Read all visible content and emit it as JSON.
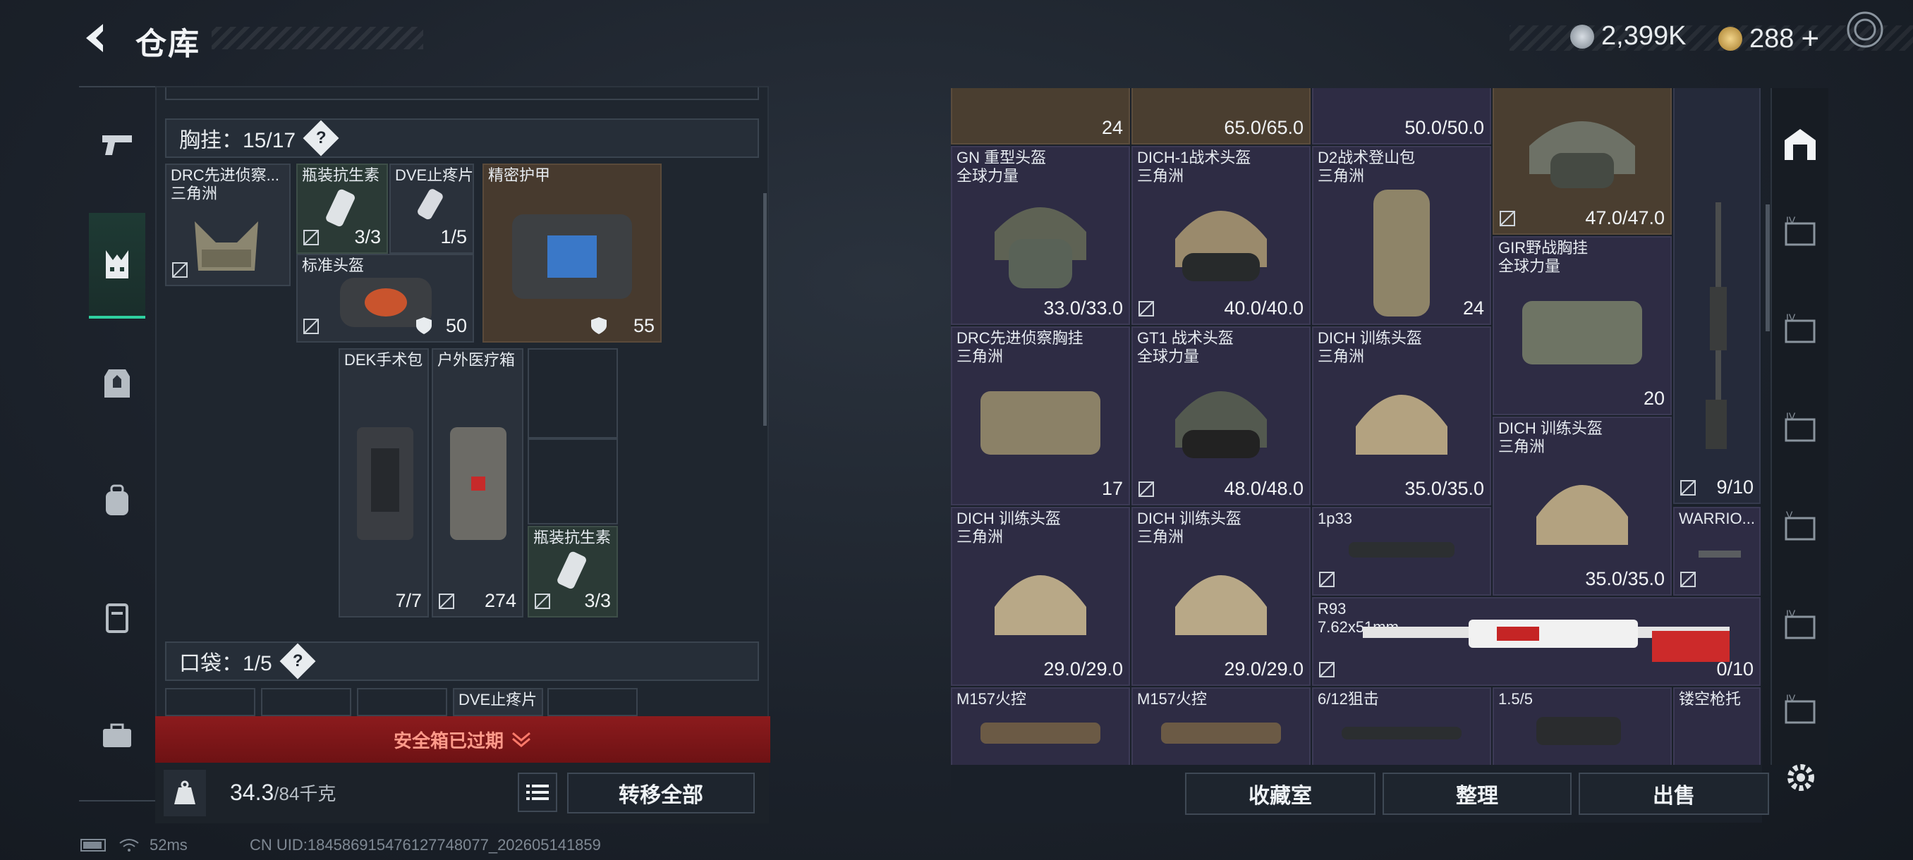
{
  "header": {
    "title": "仓库",
    "currency1": "2,399K",
    "currency2": "288",
    "currency2_plus": "+"
  },
  "left": {
    "chest_rig_header": "胸挂：15/17",
    "pocket_header": "口袋：1/5",
    "help": "?",
    "items": [
      {
        "label": "DRC先进侦察...",
        "sub": "三角洲"
      },
      {
        "label": "瓶装抗生素",
        "value": "3/3"
      },
      {
        "label": "DVE止疼片",
        "value": "1/5"
      },
      {
        "label": "精密护甲",
        "value": "55"
      },
      {
        "label": "标准头盔",
        "value": "50"
      },
      {
        "label": "DEK手术包",
        "value": "7/7"
      },
      {
        "label": "户外医疗箱",
        "value": "274"
      },
      {
        "label": "瓶装抗生素",
        "value": "3/3"
      },
      {
        "label": "DVE止疼片"
      }
    ],
    "safe_box_expired": "安全箱已过期",
    "weight": "34.3",
    "weight_max": "/84千克",
    "transfer_all": "转移全部"
  },
  "right": {
    "top_row": [
      {
        "value": "24"
      },
      {
        "value": "65.0/65.0"
      },
      {
        "value": "50.0/50.0"
      },
      {
        "value": "47.0/47.0"
      }
    ],
    "items": [
      {
        "label": "GN 重型头盔",
        "sub": "全球力量",
        "value": "33.0/33.0"
      },
      {
        "label": "DICH-1战术头盔",
        "sub": "三角洲",
        "value": "40.0/40.0"
      },
      {
        "label": "D2战术登山包",
        "sub": "三角洲",
        "value": "24"
      },
      {
        "label": "GIR野战胸挂",
        "sub": "全球力量",
        "value": "20"
      },
      {
        "label": "DRC先进侦察胸挂",
        "sub": "三角洲",
        "value": "17"
      },
      {
        "label": "GT1 战术头盔",
        "sub": "全球力量",
        "value": "48.0/48.0"
      },
      {
        "label": "DICH 训练头盔",
        "sub": "三角洲",
        "value": "35.0/35.0"
      },
      {
        "label": "DICH 训练头盔",
        "sub": "三角洲",
        "value": "35.0/35.0"
      },
      {
        "label": "DICH 训练头盔",
        "sub": "三角洲",
        "value": "29.0/29.0"
      },
      {
        "label": "DICH 训练头盔",
        "sub": "三角洲",
        "value": "29.0/29.0"
      },
      {
        "label": "1p33"
      },
      {
        "label": "WARRIO..."
      },
      {
        "label": "R93",
        "sub": "7.62x51mm",
        "value": "0/10"
      },
      {
        "label": "M157火控"
      },
      {
        "label": "M157火控"
      },
      {
        "label": "6/12狙击"
      },
      {
        "label": "1.5/5"
      },
      {
        "label": "镂空枪托"
      }
    ],
    "rifle_value": "9/10",
    "buttons": {
      "collection": "收藏室",
      "sort": "整理",
      "sell": "出售"
    }
  },
  "status": {
    "ping": "52ms",
    "uid": "CN UID:1845869154761277480​77_202605141859"
  }
}
